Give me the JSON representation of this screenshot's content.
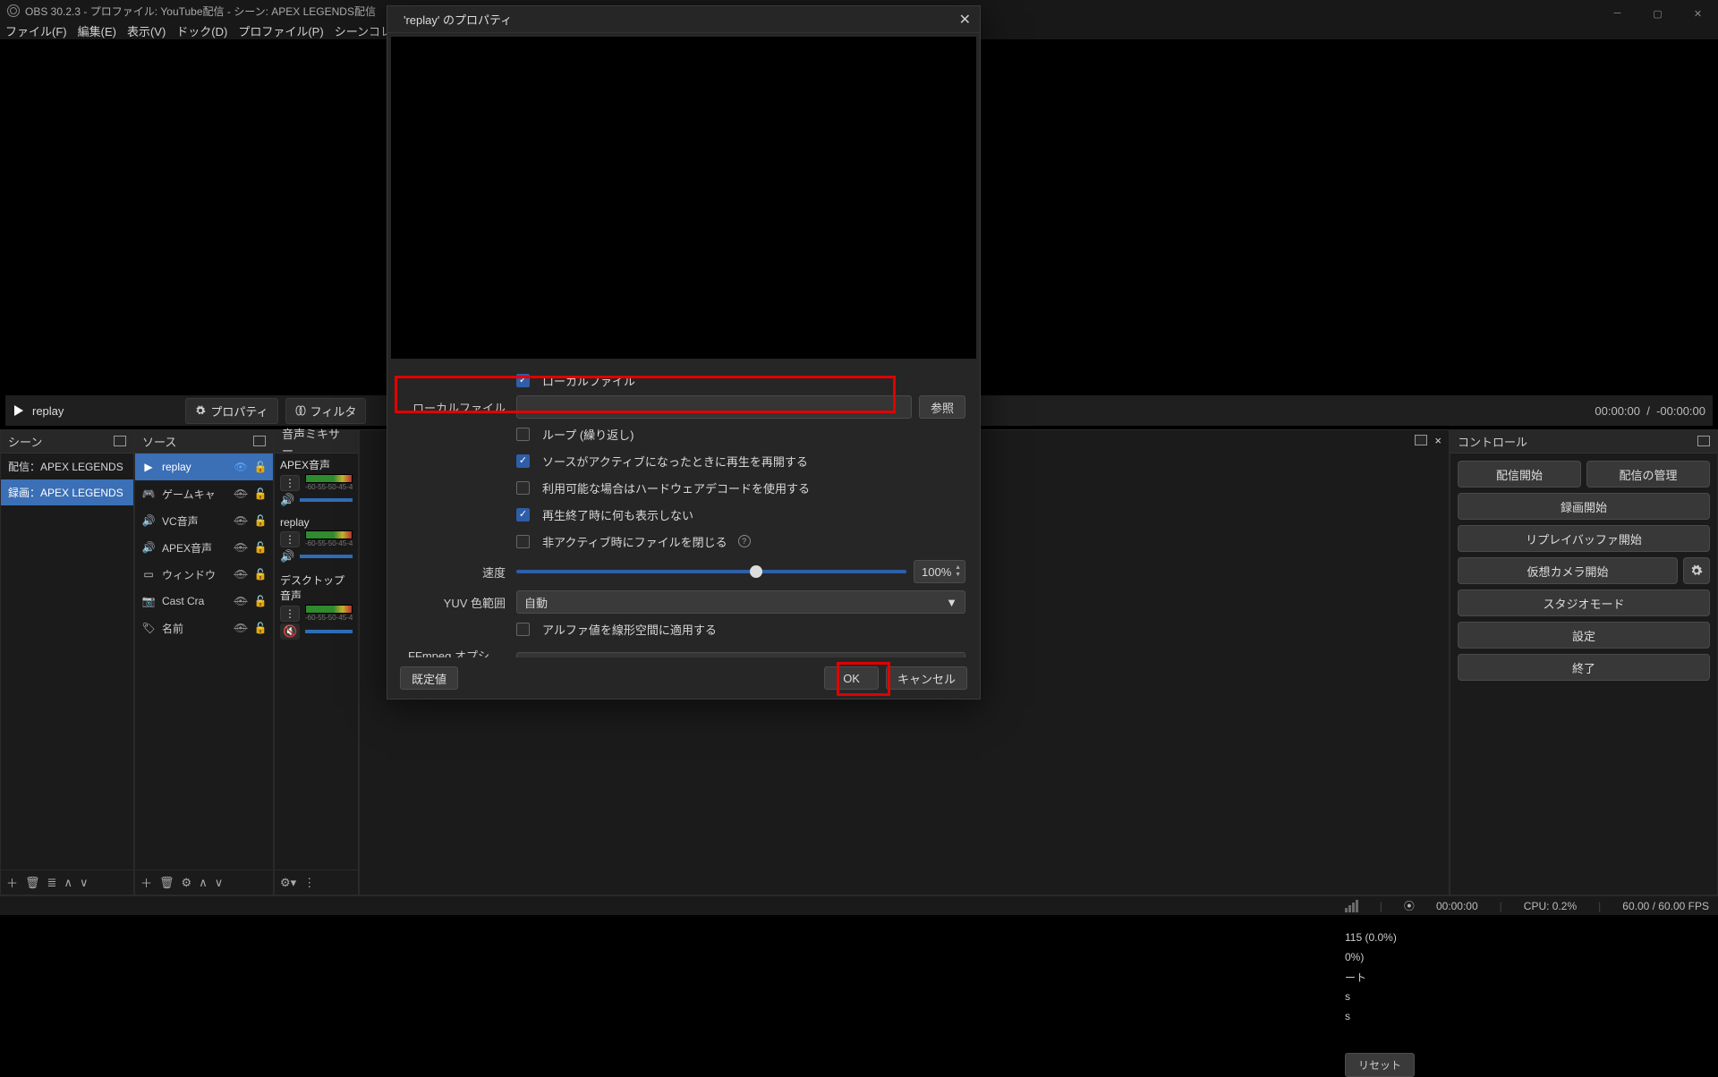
{
  "titlebar": {
    "app_title": "OBS 30.2.3 - プロファイル: YouTube配信 - シーン: APEX LEGENDS配信"
  },
  "menubar": {
    "file": "ファイル(F)",
    "edit": "編集(E)",
    "view": "表示(V)",
    "dock": "ドック(D)",
    "profile": "プロファイル(P)",
    "scene_collection": "シーンコレクション"
  },
  "preview_toolbar": {
    "source_name": "replay",
    "properties_btn": "プロパティ",
    "filter_btn": "フィルタ",
    "time_current": "00:00:00",
    "time_total": "-00:00:00"
  },
  "scenes": {
    "title": "シーン",
    "items": [
      {
        "label": "配信：APEX LEGENDS"
      },
      {
        "label": "録画：APEX LEGENDS"
      }
    ]
  },
  "sources": {
    "title": "ソース",
    "items": [
      {
        "icon": "play",
        "label": "replay",
        "visible": true
      },
      {
        "icon": "gamepad",
        "label": "ゲームキャ",
        "visible": false
      },
      {
        "icon": "audio",
        "label": "VC音声",
        "visible": false
      },
      {
        "icon": "audio",
        "label": "APEX音声",
        "visible": false
      },
      {
        "icon": "window",
        "label": "ウィンドウ",
        "visible": false
      },
      {
        "icon": "camera",
        "label": "Cast Cra",
        "visible": false
      },
      {
        "icon": "tag",
        "label": "名前",
        "visible": false
      }
    ]
  },
  "mixer": {
    "title": "音声ミキサー",
    "ticks": "-60-55-50-45-4",
    "tracks": [
      {
        "name": "APEX音声",
        "muted": false
      },
      {
        "name": "replay",
        "muted": false
      },
      {
        "name": "デスクトップ音声",
        "muted": true
      }
    ]
  },
  "transitions": {
    "popout_close": "×",
    "frag1": "115 (0.0%)",
    "frag2": "0%)",
    "frag3": "ート",
    "frag4": "s",
    "frag5": "s",
    "reset": "リセット"
  },
  "controls": {
    "title": "コントロール",
    "start_stream": "配信開始",
    "manage_stream": "配信の管理",
    "start_record": "録画開始",
    "replay_buffer": "リプレイバッファ開始",
    "virtual_cam": "仮想カメラ開始",
    "studio_mode": "スタジオモード",
    "settings": "設定",
    "exit": "終了"
  },
  "statusbar": {
    "rec_time": "00:00:00",
    "cpu": "CPU: 0.2%",
    "fps": "60.00 / 60.00 FPS"
  },
  "dialog": {
    "title": "'replay' のプロパティ",
    "local_file_chk": "ローカルファイル",
    "local_file_lbl": "ローカルファイル",
    "browse": "参照",
    "loop": "ループ (繰り返し)",
    "resume_on_active": "ソースがアクティブになったときに再生を再開する",
    "hw_decode": "利用可能な場合はハードウェアデコードを使用する",
    "hide_on_end": "再生終了時に何も表示しない",
    "close_inactive": "非アクティブ時にファイルを閉じる",
    "speed_lbl": "速度",
    "speed_value": "100%",
    "yuv_lbl": "YUV 色範囲",
    "yuv_value": "自動",
    "alpha_linear": "アルファ値を線形空間に適用する",
    "ffmpeg_lbl": "FFmpeg オプション",
    "defaults": "既定値",
    "ok": "OK",
    "cancel": "キャンセル"
  }
}
